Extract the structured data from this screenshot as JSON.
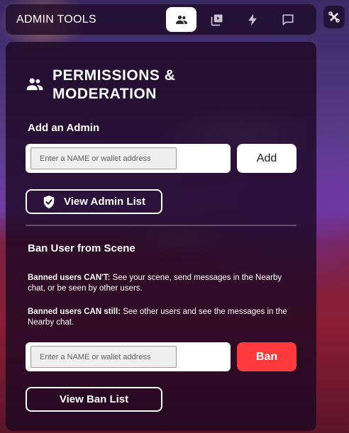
{
  "topbar": {
    "title": "ADMIN TOOLS",
    "tabs": [
      {
        "icon": "users-icon",
        "active": true
      },
      {
        "icon": "video-library-icon",
        "active": false
      },
      {
        "icon": "lightning-icon",
        "active": false
      },
      {
        "icon": "chat-bubble-icon",
        "active": false
      }
    ]
  },
  "corner": {
    "icon": "tools-cross-icon"
  },
  "panel": {
    "title": "PERMISSIONS & MODERATION",
    "add_admin": {
      "heading": "Add an Admin",
      "placeholder": "Enter a NAME or wallet address",
      "button": "Add",
      "view_list": "View Admin List"
    },
    "ban": {
      "heading": "Ban User from Scene",
      "cant_label": "Banned users CAN'T:",
      "cant_text": " See your scene, send messages in the Nearby chat, or be seen by other users.",
      "can_label": "Banned users CAN still:",
      "can_text": " See other users and see the messages in the Nearby chat.",
      "placeholder": "Enter a NAME or wallet address",
      "button": "Ban",
      "view_list": "View Ban List"
    }
  },
  "colors": {
    "ban_button": "#ff3a3d",
    "panel_bg": "#1c0822",
    "accent_white": "#ffffff"
  }
}
